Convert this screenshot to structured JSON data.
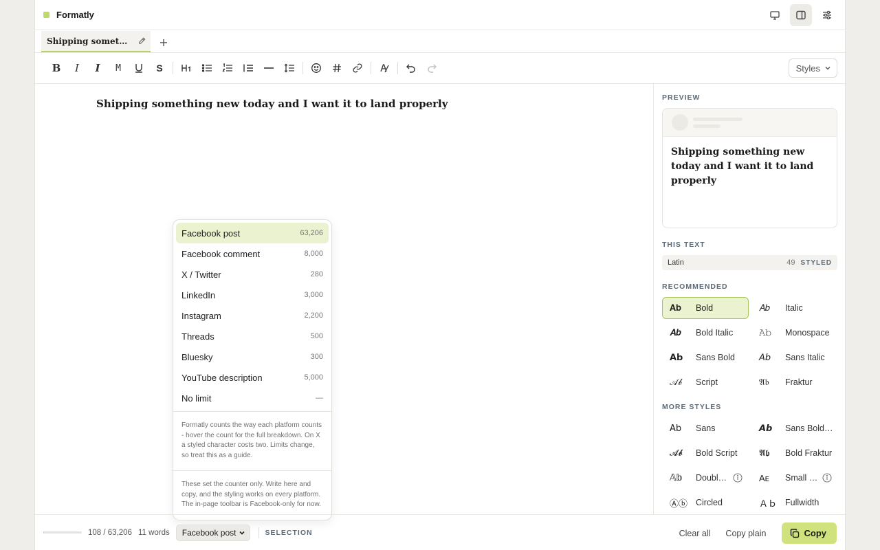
{
  "app": {
    "name": "Formatly",
    "brand_color": "#bcd96a"
  },
  "title_icons": [
    "monitor-icon",
    "split-panel-icon",
    "sliders-icon"
  ],
  "tab": {
    "label": "Shipping somethin…"
  },
  "toolbar": {
    "buttons": [
      "bold",
      "italic",
      "italic-serif",
      "monospace-m",
      "underline",
      "strikethrough",
      "heading",
      "bullet-list",
      "numbered-list",
      "quote",
      "divider",
      "line-spacing",
      "emoji",
      "hashtag",
      "link",
      "clear-format",
      "undo",
      "redo"
    ],
    "styles_label": "Styles"
  },
  "editor": {
    "text": "Shipping something new today and I want it to land properly"
  },
  "dropdown": {
    "items": [
      {
        "label": "Facebook post",
        "count": "63,206"
      },
      {
        "label": "Facebook comment",
        "count": "8,000"
      },
      {
        "label": "X / Twitter",
        "count": "280"
      },
      {
        "label": "LinkedIn",
        "count": "3,000"
      },
      {
        "label": "Instagram",
        "count": "2,200"
      },
      {
        "label": "Threads",
        "count": "500"
      },
      {
        "label": "Bluesky",
        "count": "300"
      },
      {
        "label": "YouTube description",
        "count": "5,000"
      },
      {
        "label": "No limit",
        "count": "—"
      }
    ],
    "note1": "Formatly counts the way each platform counts - hover the count for the full breakdown. On X a styled character costs two. Limits change, so treat this as a guide.",
    "note2": "These set the counter only. Write here and copy, and the styling works on every platform. The in-page toolbar is Facebook-only for now."
  },
  "panel": {
    "preview_label": "PREVIEW",
    "preview_text": "Shipping something new today and I want it to land properly",
    "this_text_label": "THIS TEXT",
    "this_text": {
      "script": "Latin",
      "count": "49",
      "badge": "STYLED"
    },
    "recommended_label": "RECOMMENDED",
    "recommended": [
      {
        "sample": "𝐀𝐛",
        "label": "Bold"
      },
      {
        "sample": "𝐴𝑏",
        "label": "Italic"
      },
      {
        "sample": "𝑨𝒃",
        "label": "Bold Italic"
      },
      {
        "sample": "𝙰𝚋",
        "label": "Monospace"
      },
      {
        "sample": "𝗔𝗯",
        "label": "Sans Bold"
      },
      {
        "sample": "𝘈𝘣",
        "label": "Sans Italic"
      },
      {
        "sample": "𝒜𝒷",
        "label": "Script"
      },
      {
        "sample": "𝔄𝔟",
        "label": "Fraktur"
      }
    ],
    "more_label": "MORE STYLES",
    "more": [
      {
        "sample": "𝖠𝖻",
        "label": "Sans"
      },
      {
        "sample": "𝘼𝙗",
        "label": "Sans Bold…"
      },
      {
        "sample": "𝓐𝓫",
        "label": "Bold Script"
      },
      {
        "sample": "𝕬𝖇",
        "label": "Bold Fraktur"
      },
      {
        "sample": "𝔸𝕓",
        "label": "Doubl…"
      },
      {
        "sample": "Aᴇ",
        "label": "Small …"
      },
      {
        "sample": "Ⓐⓑ",
        "label": "Circled"
      },
      {
        "sample": "Ａｂ",
        "label": "Fullwidth"
      }
    ]
  },
  "footer": {
    "progress_fraction": 0.0017,
    "count": "108 / 63,206",
    "words": "11 words",
    "platform": "Facebook post",
    "selection_label": "SELECTION",
    "clear_all": "Clear all",
    "copy_plain": "Copy plain",
    "copy": "Copy"
  }
}
